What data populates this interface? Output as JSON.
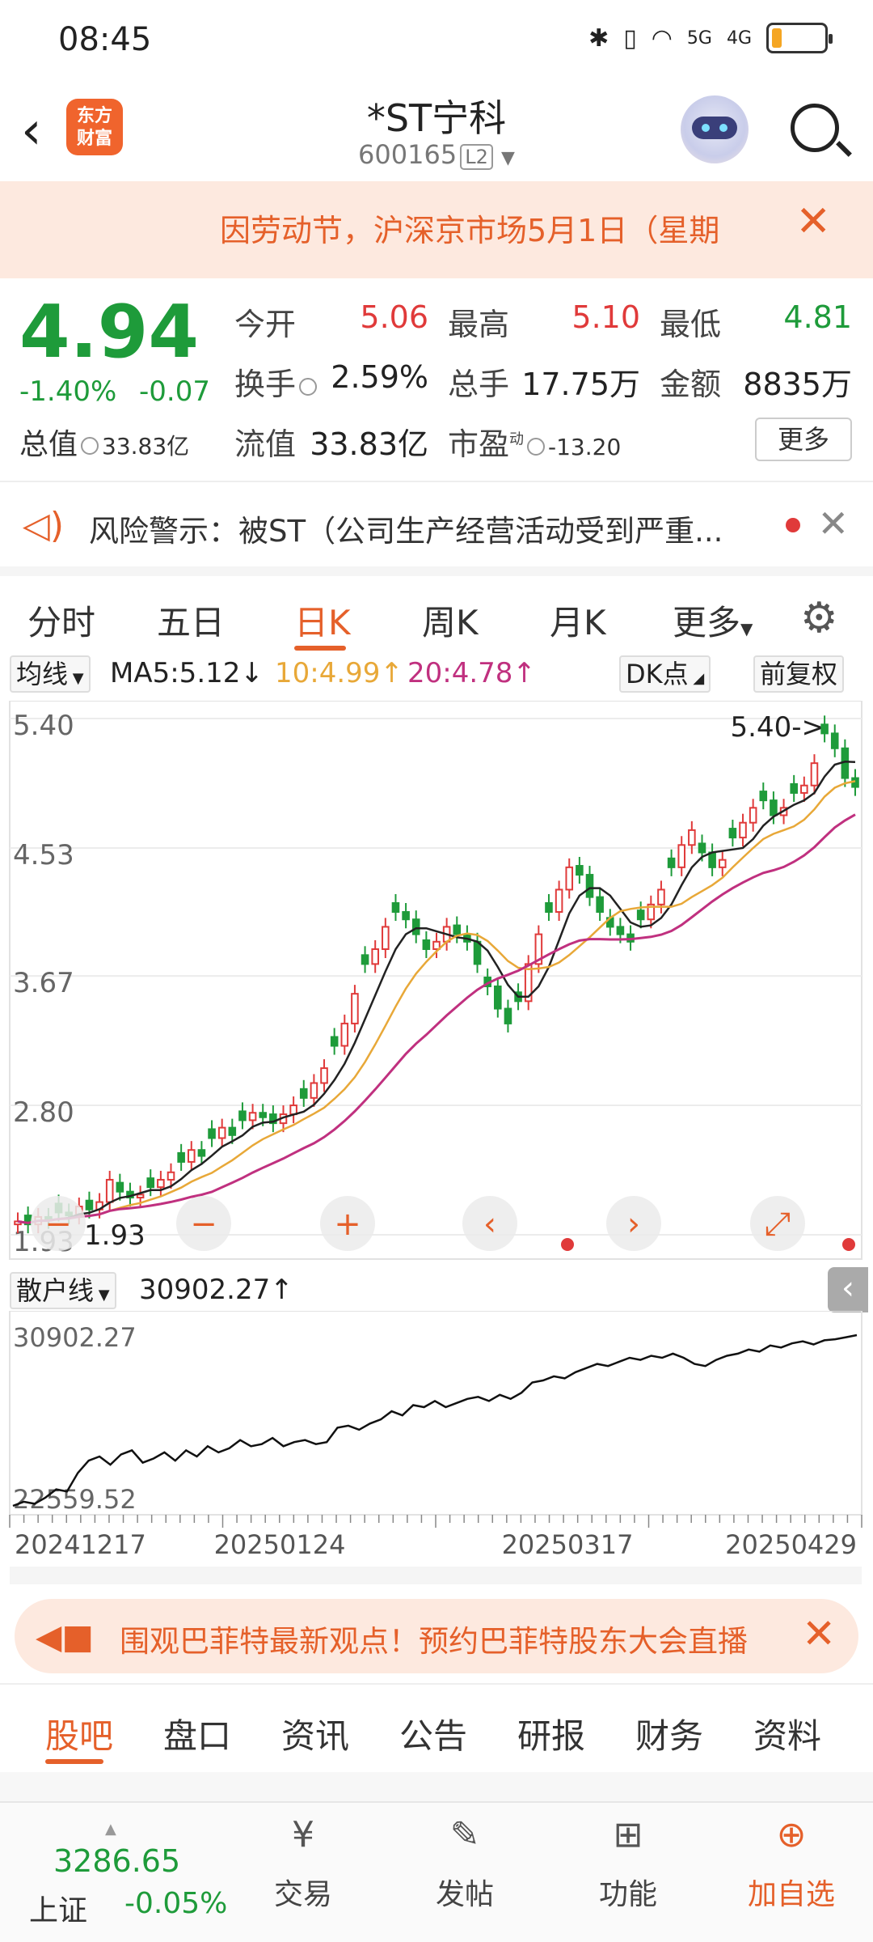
{
  "status": {
    "time": "08:45",
    "signal1": "5G",
    "signal2": "4G",
    "battery_level": 0.2
  },
  "header": {
    "logo_line1": "东方",
    "logo_line2": "财富",
    "title": "*ST宁科",
    "code": "600165",
    "level_badge": "L2"
  },
  "notice": {
    "text": "因劳动节，沪深京市场5月1日（星期"
  },
  "quote": {
    "price": "4.94",
    "change_pct": "-1.40%",
    "change_amt": "-0.07",
    "open_label": "今开",
    "open": "5.06",
    "high_label": "最高",
    "high": "5.10",
    "low_label": "最低",
    "low": "4.81",
    "turnover_label": "换手",
    "turnover": "2.59%",
    "volume_label": "总手",
    "volume": "17.75万",
    "amount_label": "金额",
    "amount": "8835万",
    "mktcap_label": "总值",
    "mktcap": "33.83亿",
    "float_label": "流值",
    "float": "33.83亿",
    "pe_label": "市盈",
    "pe_sup": "动",
    "pe": "-13.20",
    "more": "更多"
  },
  "risk": {
    "text": "风险警示：被ST（公司生产经营活动受到严重..."
  },
  "tabs": {
    "t1": "分时",
    "t2": "五日",
    "t3": "日K",
    "t4": "周K",
    "t5": "月K",
    "t6": "更多"
  },
  "ma": {
    "select": "均线",
    "ma5": "MA5:5.12↓",
    "ma10": "10:4.99↑",
    "ma20": "20:4.78↑",
    "dk": "DK点",
    "adj": "前复权"
  },
  "colors": {
    "up": "#e03a3a",
    "down": "#1e9b3a",
    "ma5": "#222222",
    "ma10": "#e8a838",
    "ma20": "#c0307f",
    "accent": "#e5602a"
  },
  "chart_data": [
    {
      "type": "candlestick",
      "title": "",
      "y_ticks": [
        "5.40",
        "4.53",
        "3.67",
        "2.80",
        "1.93"
      ],
      "ylim": [
        1.93,
        5.4
      ],
      "max_annotation": "5.40->",
      "min_annotation": "1.93",
      "x_ticks": [
        "20241217",
        "20250124",
        "20250317",
        "20250429"
      ],
      "close": [
        2.02,
        2.0,
        2.05,
        2.03,
        2.08,
        2.06,
        2.12,
        2.1,
        2.15,
        2.3,
        2.22,
        2.18,
        2.2,
        2.25,
        2.3,
        2.35,
        2.42,
        2.5,
        2.46,
        2.58,
        2.65,
        2.6,
        2.7,
        2.75,
        2.72,
        2.68,
        2.74,
        2.8,
        2.85,
        2.95,
        3.05,
        3.2,
        3.35,
        3.55,
        3.75,
        3.85,
        4.0,
        4.1,
        4.05,
        3.95,
        3.85,
        3.9,
        4.0,
        3.95,
        3.9,
        3.75,
        3.6,
        3.45,
        3.35,
        3.5,
        3.75,
        3.95,
        4.1,
        4.25,
        4.4,
        4.35,
        4.2,
        4.1,
        4.0,
        3.95,
        3.9,
        4.05,
        4.15,
        4.25,
        4.4,
        4.55,
        4.65,
        4.5,
        4.4,
        4.45,
        4.6,
        4.7,
        4.8,
        4.85,
        4.75,
        4.8,
        4.9,
        4.95,
        5.1,
        5.3,
        5.2,
        5.0,
        4.94
      ],
      "ma": [
        {
          "name": "MA5",
          "last": 5.12
        },
        {
          "name": "MA10",
          "last": 4.99
        },
        {
          "name": "MA20",
          "last": 4.78
        }
      ]
    },
    {
      "type": "line",
      "title": "",
      "y_ticks": [
        "30902.27",
        "22559.52"
      ],
      "ylim": [
        22559.52,
        30902.27
      ],
      "x_ticks": [
        "20241217",
        "20250124",
        "20250317",
        "20250429"
      ],
      "values": [
        22600,
        22800,
        22700,
        23000,
        23400,
        23300,
        24200,
        24800,
        25000,
        24600,
        25100,
        25300,
        24700,
        24900,
        25200,
        24800,
        25300,
        25000,
        25500,
        25200,
        25400,
        25800,
        25500,
        25600,
        25900,
        25500,
        25700,
        25800,
        25600,
        25700,
        26400,
        26500,
        26300,
        26600,
        26800,
        27200,
        27000,
        27500,
        27400,
        27700,
        27400,
        27600,
        27800,
        27900,
        27700,
        28000,
        27800,
        28100,
        28600,
        28700,
        28900,
        28800,
        29100,
        29300,
        29500,
        29400,
        29600,
        29800,
        29700,
        29900,
        29800,
        30000,
        29800,
        29500,
        29400,
        29700,
        29900,
        30000,
        30200,
        30100,
        30400,
        30300,
        30500,
        30600,
        30450,
        30650,
        30700,
        30800,
        30902
      ],
      "annotation": "30902.27↑"
    }
  ],
  "sub": {
    "select": "散户线",
    "value": "30902.27↑"
  },
  "promo": {
    "text": "围观巴菲特最新观点！预约巴菲特股东大会直播"
  },
  "btabs": {
    "b1": "股吧",
    "b2": "盘口",
    "b3": "资讯",
    "b4": "公告",
    "b5": "研报",
    "b6": "财务",
    "b7": "资料"
  },
  "bnav": {
    "index_value": "3286.65",
    "index_name": "上证",
    "index_change": "-0.05%",
    "trade": "交易",
    "post": "发帖",
    "func": "功能",
    "add": "加自选"
  }
}
